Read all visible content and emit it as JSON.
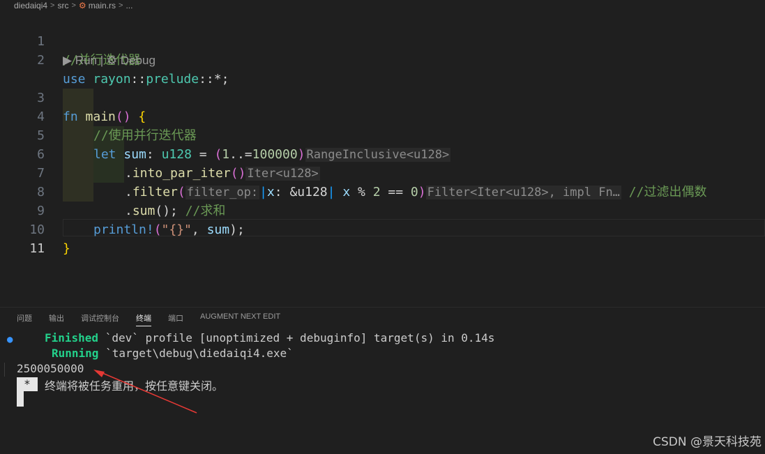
{
  "breadcrumb": {
    "items": [
      "diedaiqi4",
      "src",
      "main.rs",
      "..."
    ]
  },
  "editor": {
    "codelens": "▶ Run | ⚙ Debug",
    "line_numbers": [
      "1",
      "2",
      "3",
      "4",
      "5",
      "6",
      "7",
      "8",
      "9",
      "10",
      "11"
    ],
    "line1": {
      "comment": "//并行迭代器"
    },
    "line2": {
      "use": "use",
      "rayon": "rayon",
      "sep1": "::",
      "prelude": "prelude",
      "sep2": "::",
      "star": "*;"
    },
    "line3": {
      "fn": "fn",
      "main": "main",
      "paren": "()",
      "sp": " ",
      "brace": "{"
    },
    "line4": {
      "comment": "//使用并行迭代器"
    },
    "line5": {
      "let": "let",
      "sum": "sum",
      "colon": ": ",
      "u128": "u128",
      "eq": " = ",
      "open": "(",
      "start": "1",
      "range": "..=",
      "end": "100000",
      "close": ")",
      "hint": "RangeInclusive<u128>"
    },
    "line6": {
      "dot": ".",
      "method": "into_par_iter",
      "paren": "()",
      "hint": "Iter<u128>"
    },
    "line7": {
      "dot": ".",
      "method": "filter",
      "open": "(",
      "param_hint": "filter_op:",
      "pipe1": "|",
      "x": "x",
      "colon": ": ",
      "ref": "&u128",
      "pipe2": "|",
      "x2": "x",
      "rest": " % ",
      "two": "2",
      "eqeq": " == ",
      "zero": "0",
      "close": ")",
      "hint": "Filter<Iter<u128>, impl Fn…",
      "comment": "//过滤出偶数"
    },
    "line8": {
      "dot": ".",
      "method": "sum",
      "paren": "();",
      "comment": "//求和"
    },
    "line9": {
      "macro": "println!",
      "open": "(",
      "str": "\"{}\"",
      "comma": ", ",
      "arg": "sum",
      "close": ");"
    },
    "line10": {
      "brace": "}"
    }
  },
  "panel": {
    "tabs": [
      "问题",
      "输出",
      "调试控制台",
      "终端",
      "端口",
      "AUGMENT NEXT EDIT"
    ],
    "active_tab": "终端"
  },
  "terminal": {
    "finished_label": "Finished",
    "finished_text": "`dev` profile [unoptimized + debuginfo] target(s) in 0.14s",
    "running_label": "Running",
    "running_text": "`target\\debug\\diedaiqi4.exe`",
    "output": "2500050000",
    "star": "*",
    "message": "终端将被任务重用，按任意键关闭。"
  },
  "watermark": "CSDN @景天科技苑",
  "colors": {
    "background": "#1f1f1f",
    "keyword": "#569cd6",
    "function": "#dcdcaa",
    "type": "#4ec9b0",
    "comment": "#6a9955",
    "success": "#23d18b",
    "annotation_arrow": "#e53935"
  },
  "icons": [
    "rust-file-icon",
    "chevron-right-icon",
    "play-icon",
    "gear-icon",
    "info-dot-icon",
    "red-arrow-annotation"
  ]
}
